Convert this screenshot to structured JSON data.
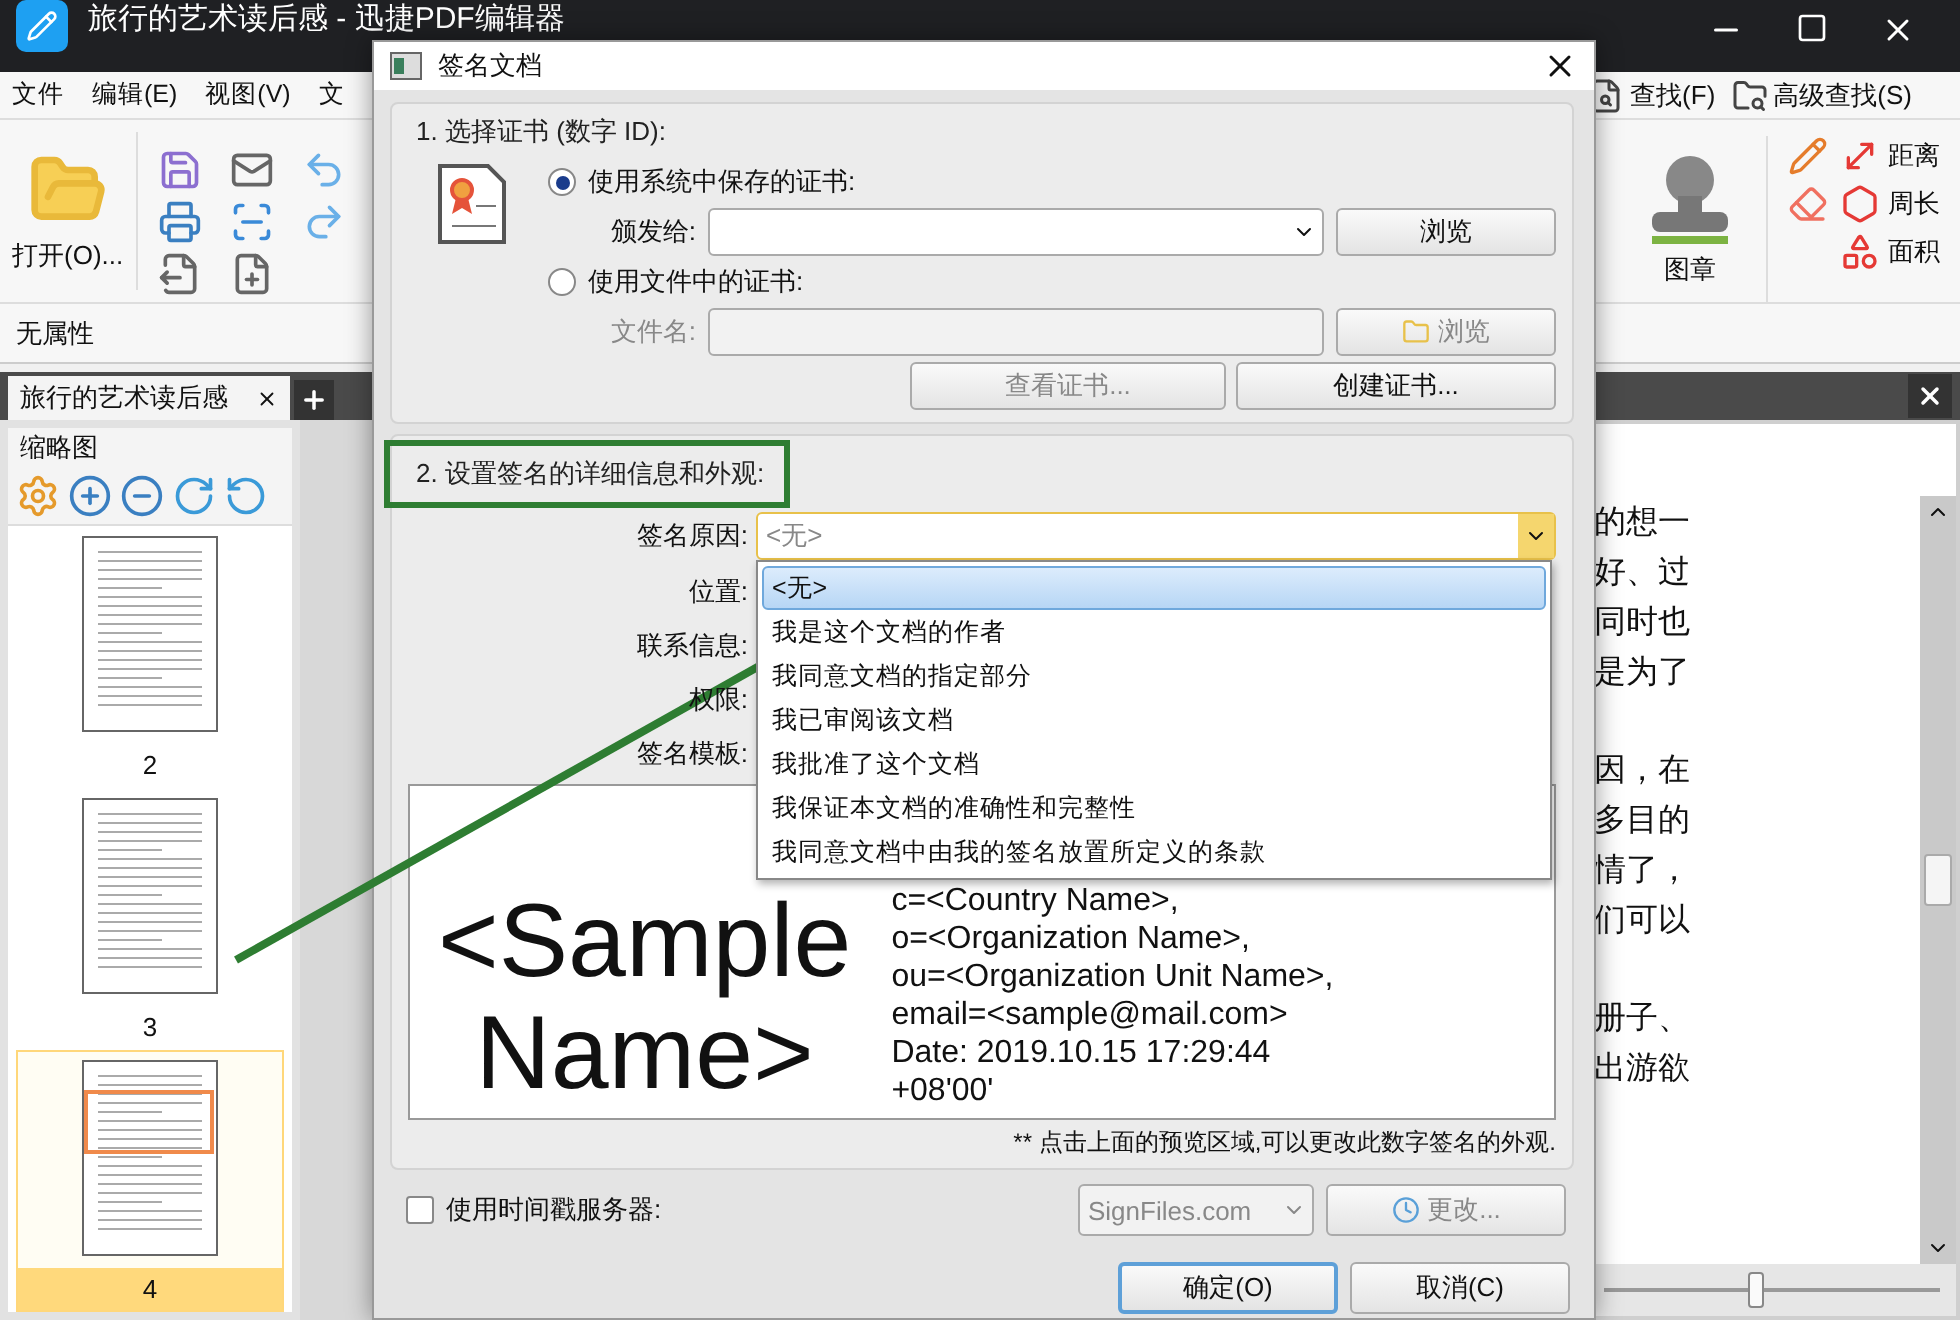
{
  "app_window": {
    "title": "旅行的艺术读后感 - 迅捷PDF编辑器"
  },
  "menu": [
    {
      "label": "文件"
    },
    {
      "label": "编辑(E)"
    },
    {
      "label": "视图(V)"
    },
    {
      "label": "文"
    }
  ],
  "find_buttons": [
    {
      "label": "查找(F)",
      "kind": "find"
    },
    {
      "label": "高级查找(S)",
      "kind": "advanced"
    }
  ],
  "ribbon": {
    "open_label": "打开(O)...",
    "stamp_label": "图章",
    "measure": [
      {
        "label": "距离",
        "kind": "distance"
      },
      {
        "label": "周长",
        "kind": "perimeter"
      },
      {
        "label": "面积",
        "kind": "area"
      }
    ]
  },
  "properties_bar": "无属性",
  "document_tabs": [
    {
      "label": "旅行的艺术读后感",
      "selected": true
    }
  ],
  "thumbnails": {
    "title": "缩略图",
    "pages": [
      {
        "number": "2",
        "selected": false
      },
      {
        "number": "3",
        "selected": false
      },
      {
        "number": "4",
        "selected": true
      }
    ]
  },
  "zoom": {
    "level": 0.45
  },
  "document_paragraphs": [
    [
      "的想一",
      "好、过",
      "同时也",
      "是为了"
    ],
    [
      "因，在",
      "多目的",
      "情了，",
      "们可以"
    ],
    [
      "册子、",
      "出游欲"
    ]
  ],
  "dialog": {
    "title": "签名文档",
    "section_1": {
      "heading": "1. 选择证书 (数字 ID):",
      "options": [
        {
          "label": "使用系统中保存的证书:",
          "selected": true
        },
        {
          "label": "使用文件中的证书:",
          "selected": false
        }
      ],
      "issued_to_label": "颁发给:",
      "browse": {
        "label": "浏览",
        "disabled": false
      },
      "file_label": "文件名:",
      "file_disabled": true,
      "browse_file": {
        "label": "浏览",
        "disabled": true
      },
      "cert_buttons": [
        {
          "label": "查看证书...",
          "disabled": true
        },
        {
          "label": "创建证书...",
          "disabled": false
        }
      ]
    },
    "section_2": {
      "heading": "2. 设置签名的详细信息和外观:",
      "highlighted": true,
      "labels": [
        {
          "label": "签名原因:"
        },
        {
          "label": "位置:"
        },
        {
          "label": "联系信息:"
        },
        {
          "label": "权限:"
        },
        {
          "label": "签名模板:"
        }
      ],
      "reason": {
        "value": "<无>",
        "expanded": true,
        "options": [
          {
            "label": "<无>",
            "selected": true
          },
          {
            "label": "我是这个文档的作者",
            "selected": false
          },
          {
            "label": "我同意文档的指定部分",
            "selected": false
          },
          {
            "label": "我已审阅该文档",
            "selected": false
          },
          {
            "label": "我批准了这个文档",
            "selected": false
          },
          {
            "label": "我保证本文档的准确性和完整性",
            "selected": false
          },
          {
            "label": "我同意文档中由我的签名放置所定义的条款",
            "selected": false
          }
        ]
      },
      "preview": {
        "name_lines": [
          "<Sample",
          "Name>"
        ],
        "details": [
          "c=<Country Name>,",
          "o=<Organization Name>,",
          "ou=<Organization Unit Name>,",
          "email=<sample@mail.com>",
          "Date: 2019.10.15 17:29:44",
          "+08'00'"
        ]
      },
      "note": "** 点击上面的预览区域,可以更改此数字签名的外观."
    },
    "timestamp": {
      "label": "使用时间戳服务器:",
      "checked": false,
      "server": "SignFiles.com",
      "change": {
        "label": "更改...",
        "disabled": true
      }
    },
    "buttons": [
      {
        "label": "确定(O)",
        "default": true
      },
      {
        "label": "取消(C)",
        "default": false
      }
    ]
  }
}
